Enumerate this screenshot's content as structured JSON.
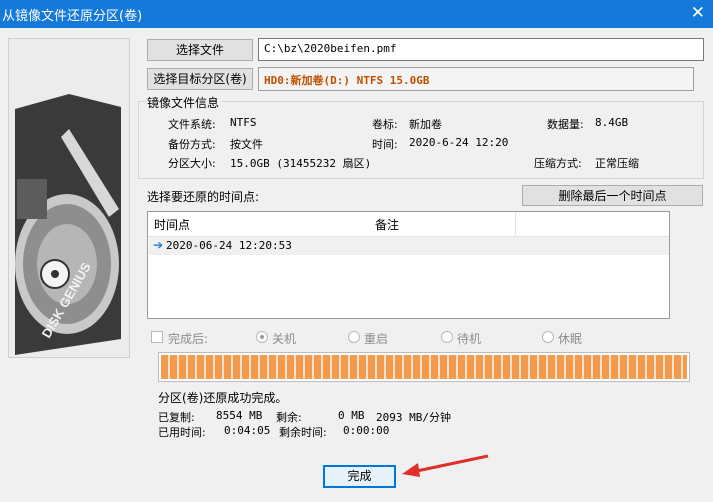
{
  "window": {
    "title": "从镜像文件还原分区(卷)",
    "close_glyph": "✕"
  },
  "side_logo": {
    "text": "DISK GENIUS"
  },
  "source": {
    "button_label": "选择文件",
    "value": "C:\\bz\\2020beifen.pmf"
  },
  "target": {
    "button_label": "选择目标分区(卷)",
    "value": "HD0:新加卷(D:) NTFS 15.0GB"
  },
  "image_info": {
    "group_label": "镜像文件信息",
    "fs_label": "文件系统:",
    "fs_value": "NTFS",
    "volume_label_label": "卷标:",
    "volume_label_value": "新加卷",
    "data_size_label": "数据量:",
    "data_size_value": "8.4GB",
    "backup_mode_label": "备份方式:",
    "backup_mode_value": "按文件",
    "time_label": "时间:",
    "time_value": "2020-6-24 12:20",
    "part_size_label": "分区大小:",
    "part_size_value": "15.0GB  (31455232 扇区)",
    "compress_label": "压缩方式:",
    "compress_value": "正常压缩"
  },
  "timepoints": {
    "prompt": "选择要还原的时间点:",
    "delete_button": "删除最后一个时间点",
    "columns": [
      "时间点",
      "备注"
    ],
    "rows": [
      {
        "time": "2020-06-24 12:20:53",
        "note": ""
      }
    ]
  },
  "after_complete": {
    "label": "完成后:",
    "options": [
      {
        "label": "关机",
        "selected": true
      },
      {
        "label": "重启",
        "selected": false
      },
      {
        "label": "待机",
        "selected": false
      },
      {
        "label": "休眠",
        "selected": false
      }
    ]
  },
  "progress": {
    "percent": 100,
    "color": "#f39a4e"
  },
  "status": {
    "message": "分区(卷)还原成功完成。",
    "copied_label": "已复制:",
    "copied_value": "8554 MB",
    "remaining_label": "剩余:",
    "remaining_value": "0 MB",
    "speed_value": "2093 MB/分钟",
    "elapsed_label": "已用时间:",
    "elapsed_value": "0:04:05",
    "remaining_time_label": "剩余时间:",
    "remaining_time_value": "0:00:00"
  },
  "done_button": "完成",
  "colors": {
    "titlebar": "#1479d8",
    "annotation_arrow": "#e0302a",
    "target_text": "#c05000"
  }
}
